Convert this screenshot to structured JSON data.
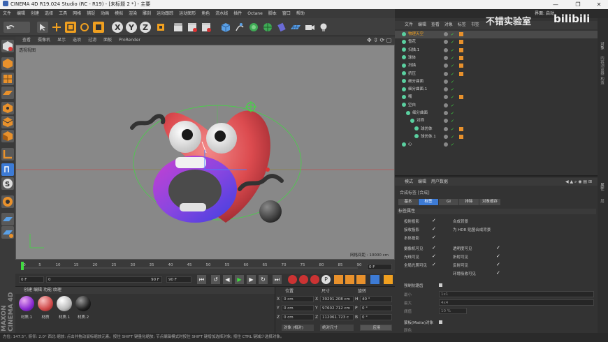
{
  "window": {
    "title": "CINEMA 4D R19.024 Studio (RC - R19) - [未标题 2 *] - 主要",
    "min": "—",
    "max": "❐",
    "close": "✕"
  },
  "menu": [
    "文件",
    "编辑",
    "创建",
    "选择",
    "工具",
    "网格",
    "捕捉",
    "动画",
    "模拟",
    "渲染",
    "雕刻",
    "运动跟踪",
    "运动图形",
    "角色",
    "流水线",
    "插件",
    "Octane",
    "脚本",
    "窗口",
    "帮助"
  ],
  "layout": {
    "label": "界面:",
    "value": "启动"
  },
  "watermark": {
    "text": "不错实验室",
    "logo": "bilibili"
  },
  "viewport": {
    "menu": [
      "查看",
      "摄像机",
      "显示",
      "选项",
      "过滤",
      "面板",
      "ProRender"
    ],
    "label": "透视视图",
    "grid_spacing": "网格间距 : 10000 cm"
  },
  "timeline": {
    "ticks": [
      "0",
      "5",
      "10",
      "15",
      "20",
      "25",
      "30",
      "35",
      "40",
      "45",
      "50",
      "55",
      "60",
      "65",
      "70",
      "75",
      "80",
      "85",
      "90"
    ],
    "frame": "0 F"
  },
  "transport": {
    "start": "0 F",
    "current": "0",
    "end": "90 F",
    "end2": "90 F"
  },
  "materials": {
    "menu": [
      "创建",
      "编辑",
      "功能",
      "纹理"
    ],
    "items": [
      "材质.1",
      "材质",
      "材质.1",
      "材质.2"
    ]
  },
  "coords": {
    "headers": [
      "位置",
      "尺寸",
      "旋转"
    ],
    "rows": [
      [
        "X",
        "0 cm",
        "X",
        "39291.208 cm",
        "H",
        "40 °"
      ],
      [
        "Y",
        "0 cm",
        "Y",
        "97602.712 cm",
        "P",
        "0 °"
      ],
      [
        "Z",
        "0 cm",
        "Z",
        "112061.723 c",
        "B",
        "0 °"
      ]
    ],
    "dropdown1": "对象 (相对)",
    "dropdown2": "绝对尺寸",
    "apply": "应用"
  },
  "objects": {
    "menu": [
      "文件",
      "编辑",
      "查看",
      "对象",
      "标签",
      "书签"
    ],
    "rows": [
      {
        "name": "物理天空",
        "indent": 0,
        "hl": true
      },
      {
        "name": "雪花",
        "indent": 0
      },
      {
        "name": "扫描.1",
        "indent": 0
      },
      {
        "name": "球体",
        "indent": 0
      },
      {
        "name": "扫描",
        "indent": 0
      },
      {
        "name": "挤压",
        "indent": 0
      },
      {
        "name": "细分曲面",
        "indent": 0
      },
      {
        "name": "细分曲面.1",
        "indent": 0
      },
      {
        "name": "嘴",
        "indent": 0
      },
      {
        "name": "空白",
        "indent": 0
      },
      {
        "name": "细分曲面",
        "indent": 1
      },
      {
        "name": "对称",
        "indent": 2
      },
      {
        "name": "球仿体",
        "indent": 3
      },
      {
        "name": "球仿体.1",
        "indent": 3
      },
      {
        "name": "心",
        "indent": 0
      }
    ]
  },
  "attributes": {
    "menu": [
      "模式",
      "编辑",
      "用户数据"
    ],
    "object_label": "合成标签 [合成]",
    "tabs": [
      "基本",
      "标签",
      "GI",
      "排除",
      "对象缓存"
    ],
    "section": "标签属性",
    "left_opts": [
      "投射投影",
      "接收投影",
      "本体投影",
      "摄像机可见",
      "光线可见",
      "全局光照可见"
    ],
    "right_opts": [
      "合成背景",
      "为 HDR 贴图合成背景",
      "透明度可见",
      "折射可见",
      "反射可见",
      "环境吸收可见"
    ],
    "extra": [
      "强制抗锯齿",
      "最小",
      "最大",
      "阈值",
      "蒙板(Matte)对象",
      "颜色"
    ],
    "min": "1x1",
    "max": "4x4",
    "thresh": "10 %"
  },
  "status": {
    "text": "方位: 147.5°, 俯仰: 2.0° 西北   缩放: 点击并拖动鼠标缩放元素。按住 SHIFT 键量化缩放; 节点编辑模式时按住 SHIFT 键增加选择对象; 按住 CTRL 键减少选择对象。"
  },
  "right_tabs": [
    "对象",
    "内容浏览器",
    "构造",
    "属性",
    "层"
  ],
  "accent": "#3d7bd5"
}
